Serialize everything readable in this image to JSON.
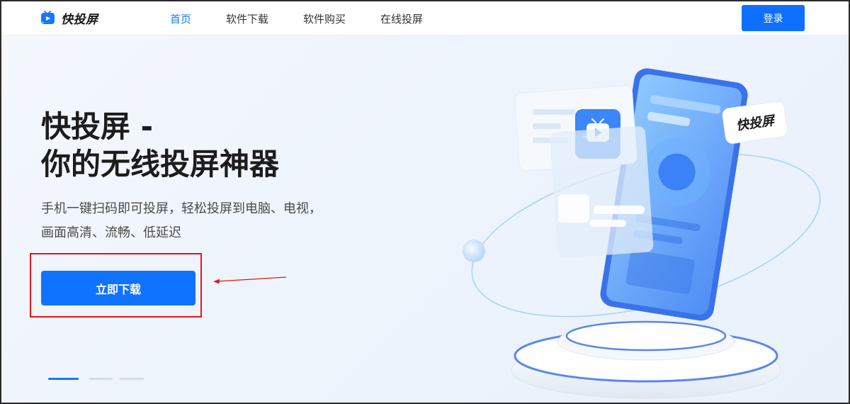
{
  "brand": {
    "name": "快投屏",
    "accent": "#1677ff"
  },
  "nav": {
    "items": [
      "首页",
      "软件下载",
      "软件购买",
      "在线投屏"
    ],
    "active_index": 0
  },
  "header": {
    "login_label": "登录"
  },
  "hero": {
    "title_line1": "快投屏 -",
    "title_line2": "你的无线投屏神器",
    "subtitle_line1": "手机一键扫码即可投屏，轻松投屏到电脑、电视，",
    "subtitle_line2": "画面高清、流畅、低延迟",
    "download_label": "立即下载"
  },
  "illustration": {
    "badge_text": "快投屏"
  },
  "carousel": {
    "slides": 3,
    "active_index": 0
  },
  "annotation": {
    "highlight_color": "#e8121b"
  }
}
